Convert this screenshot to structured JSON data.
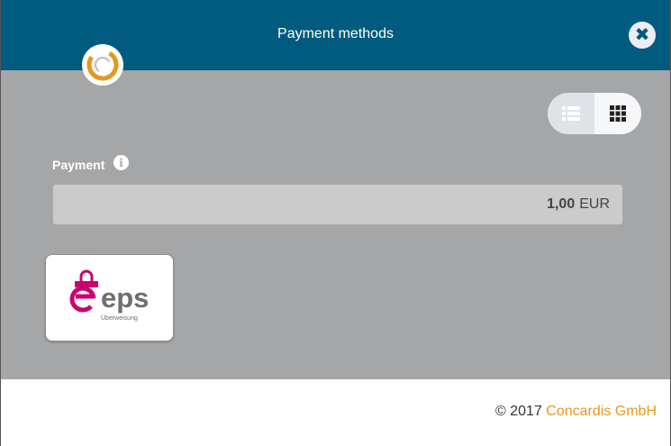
{
  "modal": {
    "title": "Payment methods",
    "close_icon": "close-icon"
  },
  "brand": {
    "logo_icon": "concardis-ring-icon",
    "accent_color": "#e8961e",
    "header_color": "#005b7f"
  },
  "view_toggle": {
    "list_icon": "list-view-icon",
    "grid_icon": "grid-view-icon",
    "selected": "grid"
  },
  "payment": {
    "label": "Payment",
    "info_icon": "info-icon",
    "amount": "1,00",
    "currency": "EUR"
  },
  "methods": [
    {
      "name": "eps",
      "subtitle": "Überweisung",
      "icon": "eps-logo-icon"
    }
  ],
  "footer": {
    "copyright_prefix": "© 2017",
    "company": "Concardis GmbH"
  }
}
